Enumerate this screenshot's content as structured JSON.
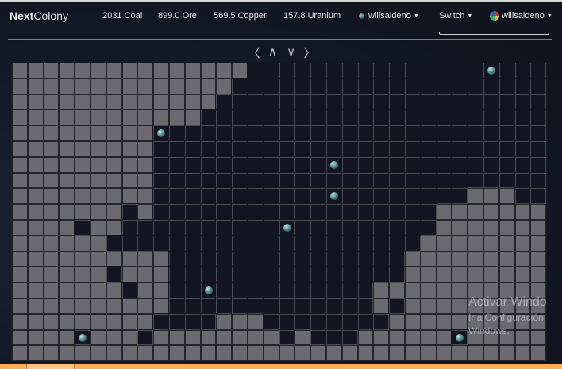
{
  "header": {
    "brand_bold": "Next",
    "brand_rest": "Colony",
    "resources": [
      "2031 Coal",
      "899.0 Ore",
      "569.5 Copper",
      "157.8 Uranium"
    ],
    "planet_selector": "willsaldeno",
    "switch_label": "Switch",
    "user_menu": "willsaldeno"
  },
  "nav": {
    "left": "〈",
    "up": "∧",
    "down": "∨",
    "right": "〉"
  },
  "map": {
    "legend": {
      "L": "unexplored",
      "D": "explored",
      "P": "planet"
    },
    "rows": [
      "LLLLLLLLLLLLLLLDDDDDDDDDDDDDDDPDDD",
      "LLLLLLLLLLLLLLDDDDDDDDDDDDDDDDDDDD",
      "LLLLLLLLLLLLLDDDDDDDDDDDDDDDDDDDDD",
      "LLLLLLLLLLLLDDDDDDDDDDDDDDDDDDDDDD",
      "LLLLLLLLLPDDDDDDDDDDDDDDDDDDDDDDDD",
      "LLLLLLLLLDDDDDDDDDDDDDDDDDDDDDDDDD",
      "LLLLLLLLLDDDDDDDDDDDPDDDDDDDDDDDDD",
      "LLLLLLLLLDDDDDDDDDDDDDDDDDDDDDDDDD",
      "LLLLLLLLLDDDDDDDDDDDPDDDDDDDDLLLDD",
      "LLLLLLLDLDDDDDDDDDDDDDDDDDDLLLLLLL",
      "LLLLDLLDDDDDDDDDDPDDDDDDDDDLLLLLLL",
      "LLLLLLDDDDDDDDDDDDDDDDDDDDLLLLLLLL",
      "LLLLLLLLLLDDDDDDDDDDDDDDDLLLLLLLLL",
      "LLLLLLDLLLDDDDDDDDDDDDDDDLLLLLLLLL",
      "LLLLLLLDLLDDPDDDDDDDDDDLLLLLLLLLLL",
      "LLLLLLLLLLDDDDDDDDDDDDDLDLLLLLLLLL",
      "LLLLLLLLLDDDDLLLDDDDDDDDLLLLLLLLLL",
      "LLLLPLLLDLLLLLLLLDLDDDLLLLLLPLLLLL",
      "LLLLLLLLLLLLLLLLLLLLLLLLLLLLLLLLLL"
    ]
  },
  "watermark": {
    "line1": "Activar Windo",
    "line2": "Ir a Configuración",
    "line3": "Windows."
  },
  "colors": {
    "taskbar": "#ffae57",
    "unexplored": "#6a6a6f",
    "explored": "#141522"
  }
}
